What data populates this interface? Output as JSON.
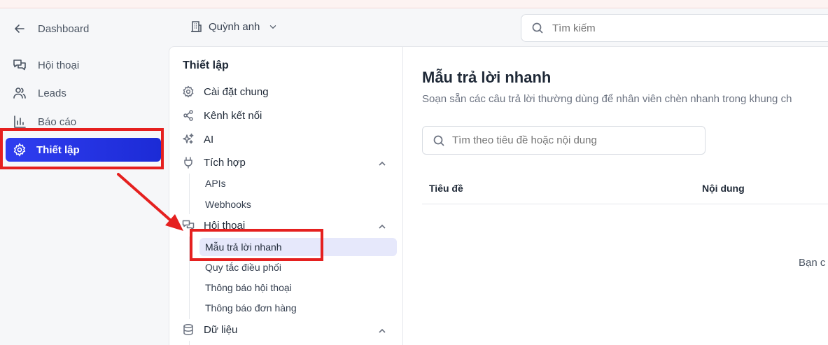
{
  "nav": {
    "back_label": "Dashboard",
    "items": [
      {
        "label": "Hội thoại",
        "icon": "chat-bubbles-icon"
      },
      {
        "label": "Leads",
        "icon": "users-icon"
      },
      {
        "label": "Báo cáo",
        "icon": "bar-chart-icon"
      }
    ],
    "active": {
      "label": "Thiết lập",
      "icon": "gear-icon"
    }
  },
  "header": {
    "workspace": "Quỳnh anh",
    "search_placeholder": "Tìm kiếm"
  },
  "settings": {
    "title": "Thiết lập",
    "items": [
      {
        "label": "Cài đặt chung",
        "icon": "gear-icon"
      },
      {
        "label": "Kênh kết nối",
        "icon": "share-icon"
      },
      {
        "label": "AI",
        "icon": "sparkles-icon"
      },
      {
        "label": "Tích hợp",
        "icon": "plug-icon",
        "expanded": true
      },
      {
        "label": "Hội thoại",
        "icon": "chat-bubbles-icon",
        "expanded": true
      },
      {
        "label": "Dữ liệu",
        "icon": "database-icon",
        "expanded": true
      }
    ],
    "integration_sub": [
      "APIs",
      "Webhooks"
    ],
    "conversation_sub": [
      "Mẫu trả lời nhanh",
      "Quy tắc điều phối",
      "Thông báo hội thoại",
      "Thông báo đơn hàng"
    ]
  },
  "main": {
    "title": "Mẫu trả lời nhanh",
    "subtitle": "Soạn sẵn các câu trả lời thường dùng để nhân viên chèn nhanh trong khung ch",
    "search_placeholder": "Tìm theo tiêu đề hoặc nội dung",
    "columns": [
      "Tiêu đề",
      "Nội dung"
    ],
    "empty_text": "Bạn c"
  },
  "colors": {
    "accent": "#2433e6",
    "annotation": "#e5201f",
    "active_sub_bg": "#e6e8fb"
  }
}
